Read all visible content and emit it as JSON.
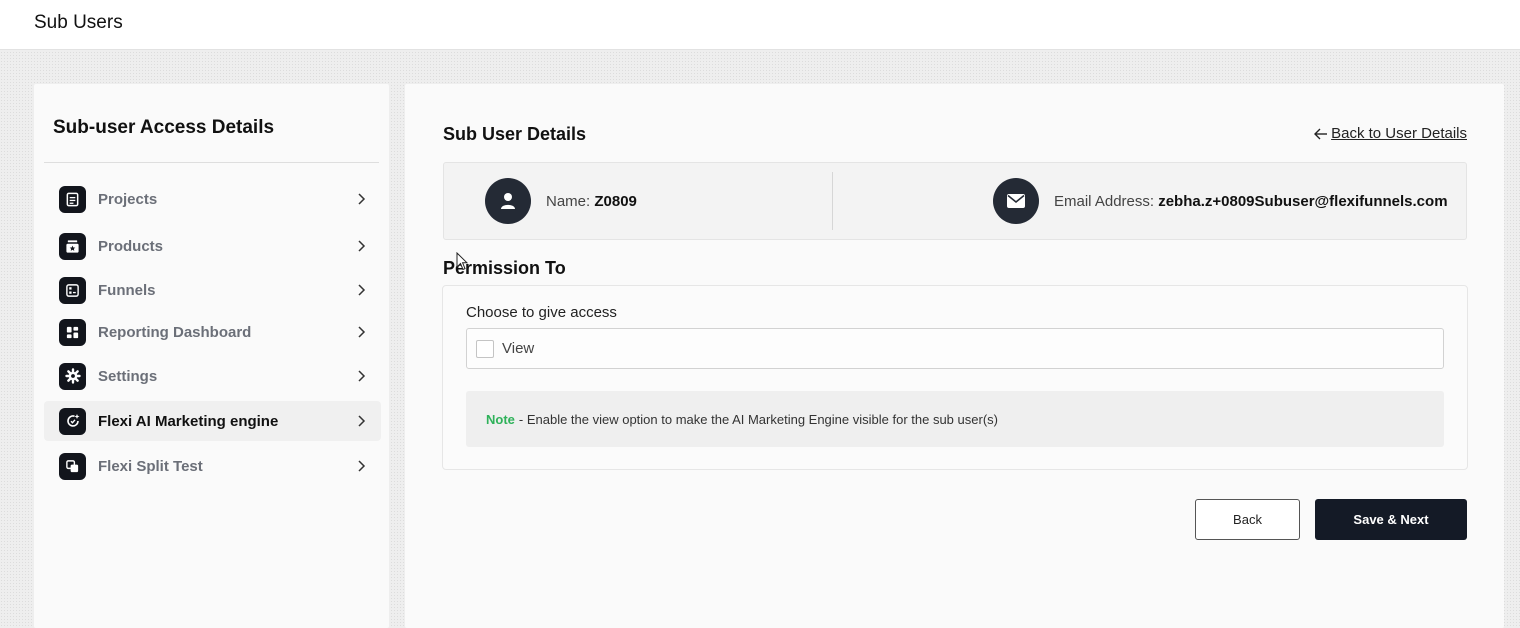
{
  "header": {
    "title": "Sub Users"
  },
  "sidebar": {
    "heading": "Sub-user Access Details",
    "items": [
      {
        "label": "Projects",
        "icon": "document-icon"
      },
      {
        "label": "Products",
        "icon": "products-icon"
      },
      {
        "label": "Funnels",
        "icon": "funnel-icon"
      },
      {
        "label": "Reporting Dashboard",
        "icon": "dashboard-icon"
      },
      {
        "label": "Settings",
        "icon": "gear-icon"
      },
      {
        "label": "Flexi AI Marketing engine",
        "icon": "ai-engine-icon",
        "active": true
      },
      {
        "label": "Flexi Split Test",
        "icon": "split-test-icon"
      }
    ]
  },
  "main": {
    "title": "Sub User Details",
    "back_link": "Back to User Details",
    "user": {
      "name_label": "Name:",
      "name_value": "Z0809",
      "email_label": "Email Address:",
      "email_value": "zebha.z+0809Subuser@flexifunnels.com"
    },
    "permission": {
      "title": "Permission To",
      "choose_label": "Choose to give access",
      "view_label": "View",
      "view_checked": false,
      "note_key": "Note",
      "note_text": "- Enable the view option to make the AI Marketing Engine visible for the sub user(s)"
    },
    "buttons": {
      "back": "Back",
      "save": "Save & Next"
    }
  },
  "colors": {
    "primary_dark": "#141a26",
    "note_green": "#2fb25a"
  }
}
